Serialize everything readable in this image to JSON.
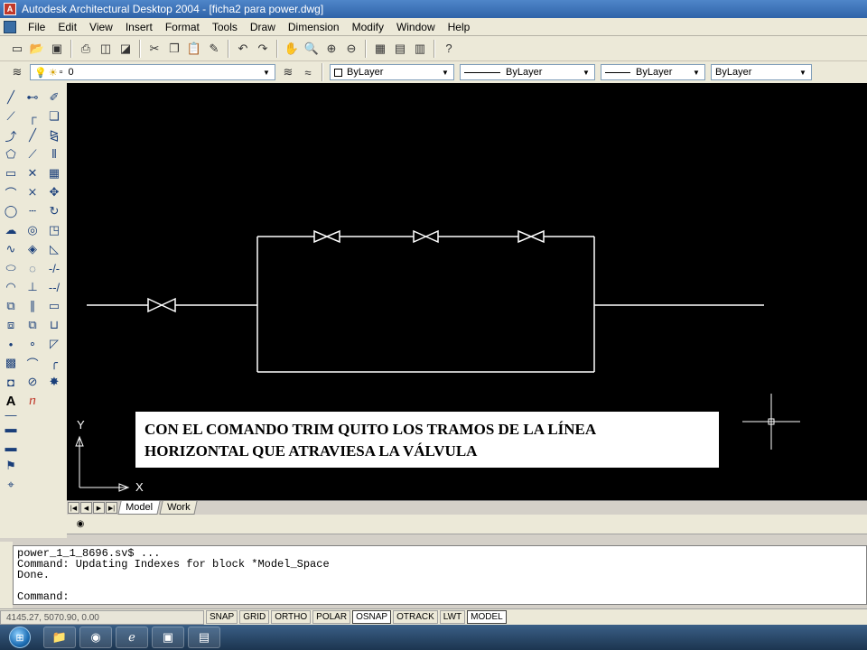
{
  "window": {
    "title": "Autodesk Architectural Desktop 2004 - [ficha2 para power.dwg]",
    "app_icon": "A"
  },
  "menu": [
    "File",
    "Edit",
    "View",
    "Insert",
    "Format",
    "Tools",
    "Draw",
    "Dimension",
    "Modify",
    "Window",
    "Help"
  ],
  "layers": {
    "current_layer": "0",
    "color": "ByLayer",
    "linetype": "ByLayer",
    "lineweight": "ByLayer",
    "plotstyle": "ByLayer"
  },
  "canvas": {
    "y_axis_label": "Y",
    "x_axis_label": "X",
    "annotation_line1": "CON EL COMANDO TRIM QUITO LOS TRAMOS DE LA LÍNEA",
    "annotation_line2": "HORIZONTAL QUE ATRAVIESA LA VÁLVULA"
  },
  "tabs": {
    "model": "Model",
    "work": "Work"
  },
  "command_window": {
    "line1": "power_1_1_8696.sv$ ...",
    "line2": "Command: Updating Indexes for block *Model_Space",
    "line3": "Done.",
    "prompt": "Command:"
  },
  "status": {
    "coords": "4145.27, 5070.90, 0.00",
    "buttons": [
      "SNAP",
      "GRID",
      "ORTHO",
      "POLAR",
      "OSNAP",
      "OTRACK",
      "LWT",
      "MODEL"
    ],
    "active": [
      "OSNAP",
      "MODEL"
    ]
  },
  "taskbar": {
    "start_icon": "windows-orb",
    "apps": [
      "folder-icon",
      "media-icon",
      "ie-icon",
      "autocad-icon",
      "powerpoint-icon"
    ]
  },
  "colors": {
    "canvas_bg": "#000000",
    "drawing_lines": "#ffffff"
  }
}
